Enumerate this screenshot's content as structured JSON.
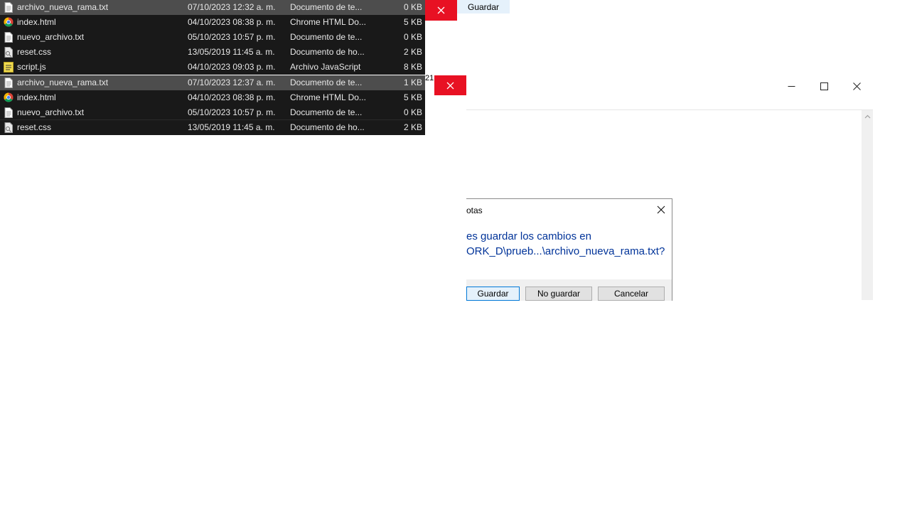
{
  "file_list_top": [
    {
      "name": "archivo_nueva_rama.txt",
      "date": "07/10/2023 12:32 a. m.",
      "type": "Documento de te...",
      "size": "0 KB",
      "icon": "text-file-icon",
      "selected": true
    },
    {
      "name": "index.html",
      "date": "04/10/2023 08:38 p. m.",
      "type": "Chrome HTML Do...",
      "size": "5 KB",
      "icon": "chrome-icon",
      "selected": false
    },
    {
      "name": "nuevo_archivo.txt",
      "date": "05/10/2023 10:57 p. m.",
      "type": "Documento de te...",
      "size": "0 KB",
      "icon": "text-file-icon",
      "selected": false
    },
    {
      "name": "reset.css",
      "date": "13/05/2019 11:45 a. m.",
      "type": "Documento de ho...",
      "size": "2 KB",
      "icon": "css-file-icon",
      "selected": false
    },
    {
      "name": "script.js",
      "date": "04/10/2023 09:03 p. m.",
      "type": "Archivo JavaScript",
      "size": "8 KB",
      "icon": "js-file-icon",
      "selected": false
    }
  ],
  "file_list_bottom": [
    {
      "name": "archivo_nueva_rama.txt",
      "date": "07/10/2023 12:37 a. m.",
      "type": "Documento de te...",
      "size": "1 KB",
      "icon": "text-file-icon",
      "selected": true
    },
    {
      "name": "index.html",
      "date": "04/10/2023 08:38 p. m.",
      "type": "Chrome HTML Do...",
      "size": "5 KB",
      "icon": "chrome-icon",
      "selected": false
    },
    {
      "name": "nuevo_archivo.txt",
      "date": "05/10/2023 10:57 p. m.",
      "type": "Documento de te...",
      "size": "0 KB",
      "icon": "text-file-icon",
      "selected": false
    },
    {
      "name": "reset.css",
      "date": "13/05/2019 11:45 a. m.",
      "type": "Documento de ho...",
      "size": "2 KB",
      "icon": "css-file-icon",
      "selected": false
    }
  ],
  "top_strip": {
    "save_label": "Guardar"
  },
  "fragment_text": "21",
  "dialog": {
    "title": "otas",
    "message_line1": "es guardar los cambios en",
    "message_line2": "ORK_D\\prueb...\\archivo_nueva_rama.txt?",
    "save_label": "Guardar",
    "dont_save_label": "No guardar",
    "cancel_label": "Cancelar"
  },
  "colors": {
    "close_red": "#e81123",
    "list_bg": "#191919",
    "selected_row": "#4d4d4d",
    "dialog_text": "#003399",
    "default_button": "#0078d7"
  }
}
